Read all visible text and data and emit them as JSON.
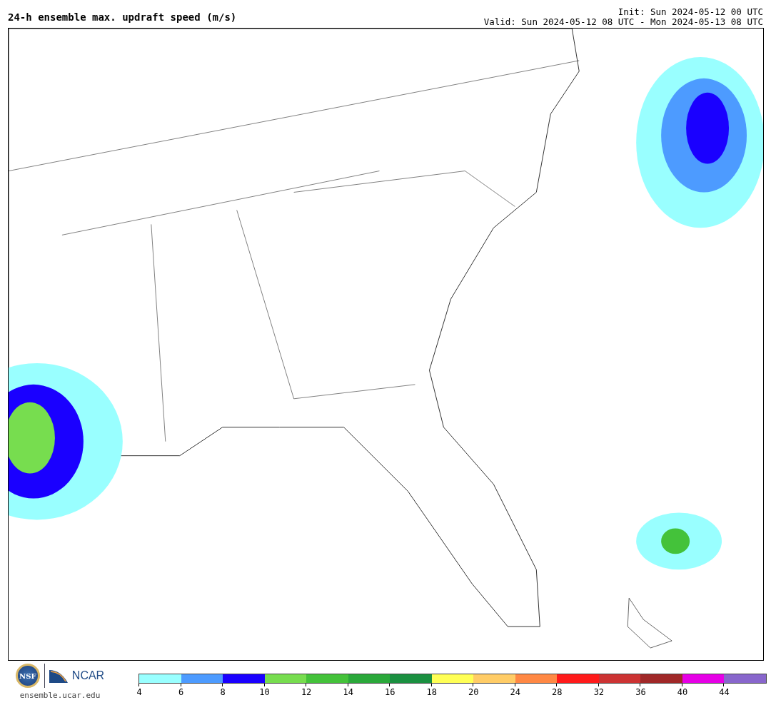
{
  "title": "24-h ensemble max. updraft speed (m/s)",
  "init": "Init: Sun 2024-05-12 00 UTC",
  "valid": "Valid: Sun 2024-05-12 08 UTC - Mon 2024-05-13 08 UTC",
  "logos": {
    "seal_text": "NSF",
    "org_text": "NCAR",
    "url": "ensemble.ucar.edu"
  },
  "colorbar": {
    "segments": [
      {
        "color": "#99ffff"
      },
      {
        "color": "#4d9bff"
      },
      {
        "color": "#1a00ff"
      },
      {
        "color": "#77dd4f"
      },
      {
        "color": "#44c23a"
      },
      {
        "color": "#2aa83a"
      },
      {
        "color": "#1a9040"
      },
      {
        "color": "#ffff55"
      },
      {
        "color": "#ffcc66"
      },
      {
        "color": "#ff8844"
      },
      {
        "color": "#ff1a1a"
      },
      {
        "color": "#cc3333"
      },
      {
        "color": "#a02828"
      },
      {
        "color": "#e600e6"
      },
      {
        "color": "#8866cc"
      }
    ],
    "ticks": [
      "4",
      "6",
      "8",
      "10",
      "12",
      "14",
      "16",
      "18",
      "20",
      "24",
      "28",
      "32",
      "36",
      "40",
      "44"
    ]
  }
}
